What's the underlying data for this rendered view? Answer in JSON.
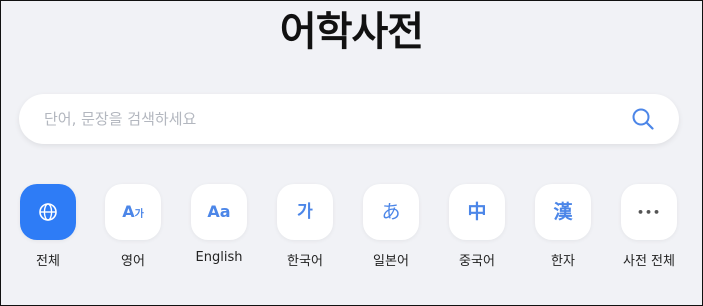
{
  "header": {
    "title": "어학사전"
  },
  "search": {
    "placeholder": "단어, 문장을 검색하세요",
    "value": ""
  },
  "categories": [
    {
      "label": "전체",
      "icon": "globe-icon",
      "active": true
    },
    {
      "label": "영어",
      "glyph_main": "A",
      "glyph_sub": "가",
      "icon": "english-korean-icon"
    },
    {
      "label": "English",
      "glyph": "Aa",
      "icon": "english-icon"
    },
    {
      "label": "한국어",
      "glyph": "가",
      "icon": "korean-icon"
    },
    {
      "label": "일본어",
      "glyph": "あ",
      "icon": "japanese-icon"
    },
    {
      "label": "중국어",
      "glyph": "中",
      "icon": "chinese-icon"
    },
    {
      "label": "한자",
      "glyph": "漢",
      "icon": "hanja-icon"
    },
    {
      "label": "사전 전체",
      "glyph": "•••",
      "icon": "more-icon"
    }
  ],
  "colors": {
    "background": "#f1f2f6",
    "accent": "#2e7cf6",
    "icon_blue": "#4c86e8"
  }
}
